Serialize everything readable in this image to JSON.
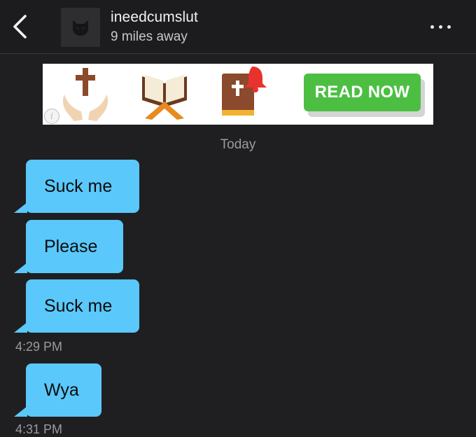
{
  "header": {
    "username": "ineedcumslut",
    "distance": "9 miles away",
    "back_icon": "chevron-left-icon",
    "avatar_icon": "mask-avatar-icon",
    "more_icon": "more-horizontal-icon"
  },
  "ad": {
    "cta_label": "READ NOW",
    "cta_color": "#4cbf43",
    "icons": [
      "praying-hands-cross-icon",
      "open-book-stand-icon",
      "bible-bell-icon"
    ],
    "info_icon": "info-icon",
    "info_glyph": "i"
  },
  "chat": {
    "date_label": "Today",
    "bubble_color": "#5ac8fa",
    "messages": [
      {
        "text": "Suck me"
      },
      {
        "text": "Please"
      },
      {
        "text": "Suck me"
      },
      {
        "text": "Wya"
      }
    ],
    "timestamps": [
      "4:29 PM",
      "4:31 PM"
    ]
  }
}
